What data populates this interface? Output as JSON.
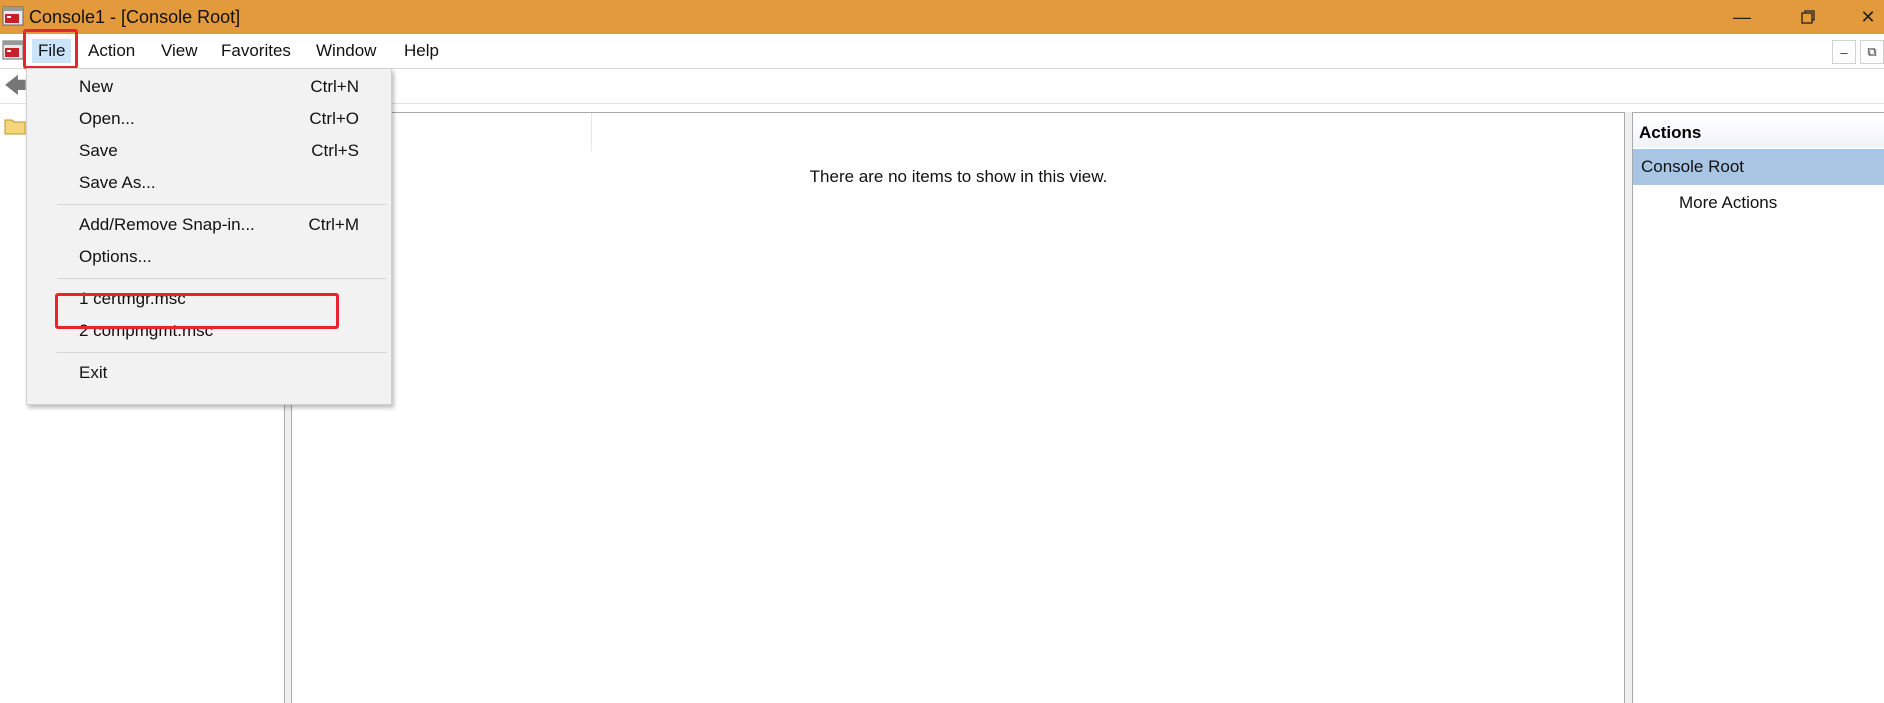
{
  "window": {
    "title": "Console1 - [Console Root]",
    "accent_color": "#e29a3c",
    "minimize_icon": "minimize-icon",
    "restore_icon": "restore-icon",
    "close_icon": "close-icon"
  },
  "menubar": {
    "items": [
      "File",
      "Action",
      "View",
      "Favorites",
      "Window",
      "Help"
    ],
    "active": "File"
  },
  "file_menu": {
    "items": [
      {
        "label": "New",
        "shortcut": "Ctrl+N"
      },
      {
        "label": "Open...",
        "shortcut": "Ctrl+O"
      },
      {
        "label": "Save",
        "shortcut": "Ctrl+S"
      },
      {
        "label": "Save As...",
        "shortcut": ""
      },
      {
        "label": "Add/Remove Snap-in...",
        "shortcut": "Ctrl+M"
      },
      {
        "label": "Options...",
        "shortcut": ""
      },
      {
        "label": "1 certmgr.msc",
        "shortcut": ""
      },
      {
        "label": "2 compmgmt.msc",
        "shortcut": ""
      },
      {
        "label": "Exit",
        "shortcut": ""
      }
    ]
  },
  "center": {
    "empty_message": "There are no items to show in this view."
  },
  "actions": {
    "header": "Actions",
    "section": "Console Root",
    "more": "More Actions"
  },
  "highlight_color": "#e8242d"
}
